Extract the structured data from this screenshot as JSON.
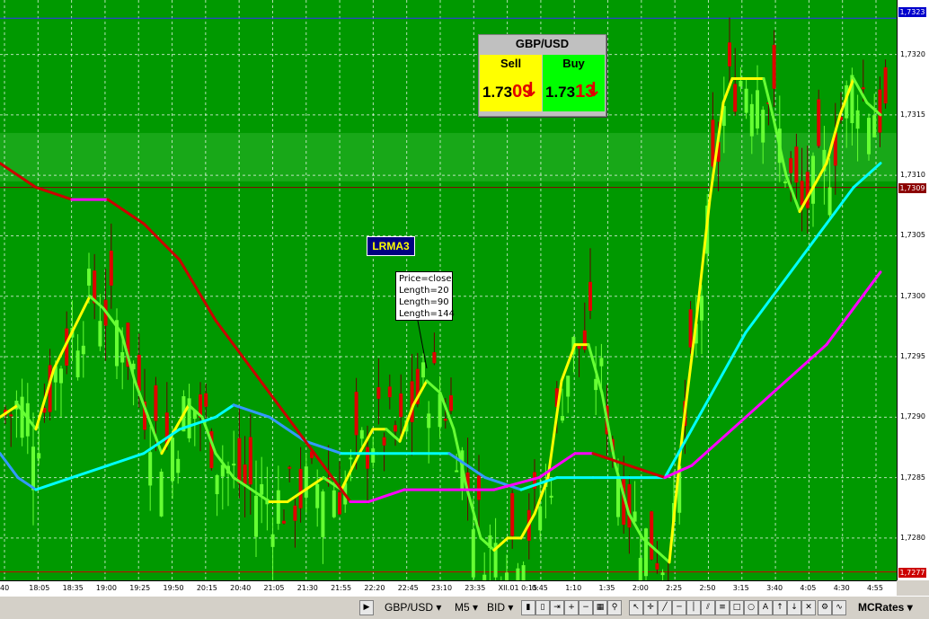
{
  "chart_data": {
    "type": "line",
    "symbol": "GBP/USD",
    "timeframe": "M5",
    "y_ticks": [
      1.728,
      1.7285,
      1.729,
      1.7295,
      1.73,
      1.7305,
      1.731,
      1.7315,
      1.732
    ],
    "y_tick_labels": [
      "1,7280",
      "1,7285",
      "1,7290",
      "1,7295",
      "1,7300",
      "1,7305",
      "1,7310",
      "1,7315",
      "1,7320"
    ],
    "ylim": [
      1.72765,
      1.73245
    ],
    "x_tick_labels": [
      "40",
      "18:05",
      "18:35",
      "19:00",
      "19:25",
      "19:50",
      "20:15",
      "20:40",
      "21:05",
      "21:30",
      "21:55",
      "22:20",
      "22:45",
      "23:10",
      "23:35",
      "XII.01 0:15",
      "0:45",
      "1:10",
      "1:35",
      "2:00",
      "2:25",
      "2:50",
      "3:15",
      "3:40",
      "4:05",
      "4:30",
      "4:55"
    ],
    "current_price_label": "1,7309",
    "high_label": "1,7323",
    "low_label": "1,7277",
    "series": [
      {
        "name": "Length=20",
        "color": "#ffff00",
        "alt_color": "#66ff33",
        "points": [
          [
            0,
            1.729
          ],
          [
            20,
            1.7291
          ],
          [
            40,
            1.7289
          ],
          [
            60,
            1.7294
          ],
          [
            80,
            1.7297
          ],
          [
            100,
            1.73
          ],
          [
            115,
            1.7299
          ],
          [
            135,
            1.7297
          ],
          [
            150,
            1.7293
          ],
          [
            170,
            1.7289
          ],
          [
            180,
            1.7287
          ],
          [
            195,
            1.7289
          ],
          [
            210,
            1.7291
          ],
          [
            225,
            1.729
          ],
          [
            240,
            1.7287
          ],
          [
            260,
            1.7285
          ],
          [
            280,
            1.7284
          ],
          [
            300,
            1.7283
          ],
          [
            320,
            1.7283
          ],
          [
            340,
            1.7284
          ],
          [
            360,
            1.7285
          ],
          [
            380,
            1.7284
          ],
          [
            400,
            1.7287
          ],
          [
            415,
            1.7289
          ],
          [
            430,
            1.7289
          ],
          [
            445,
            1.7288
          ],
          [
            460,
            1.7291
          ],
          [
            475,
            1.7293
          ],
          [
            490,
            1.7292
          ],
          [
            505,
            1.7289
          ],
          [
            520,
            1.7284
          ],
          [
            535,
            1.728
          ],
          [
            550,
            1.7279
          ],
          [
            565,
            1.728
          ],
          [
            580,
            1.728
          ],
          [
            595,
            1.7282
          ],
          [
            610,
            1.7285
          ],
          [
            625,
            1.7293
          ],
          [
            640,
            1.7296
          ],
          [
            655,
            1.7296
          ],
          [
            670,
            1.7292
          ],
          [
            685,
            1.7286
          ],
          [
            700,
            1.7282
          ],
          [
            715,
            1.728
          ],
          [
            730,
            1.7279
          ],
          [
            745,
            1.7278
          ],
          [
            760,
            1.7289
          ],
          [
            775,
            1.7298
          ],
          [
            790,
            1.7308
          ],
          [
            805,
            1.7316
          ],
          [
            815,
            1.7318
          ],
          [
            830,
            1.7318
          ],
          [
            850,
            1.7318
          ],
          [
            860,
            1.7315
          ],
          [
            875,
            1.731
          ],
          [
            890,
            1.7307
          ],
          [
            905,
            1.7309
          ],
          [
            920,
            1.7311
          ],
          [
            935,
            1.7315
          ],
          [
            950,
            1.7318
          ],
          [
            965,
            1.7316
          ],
          [
            980,
            1.7315
          ]
        ]
      },
      {
        "name": "Length=90",
        "color": "#00ffff",
        "alt_color": "#3399ff",
        "points": [
          [
            0,
            1.7287
          ],
          [
            20,
            1.7285
          ],
          [
            40,
            1.7284
          ],
          [
            80,
            1.7285
          ],
          [
            120,
            1.7286
          ],
          [
            160,
            1.7287
          ],
          [
            200,
            1.7289
          ],
          [
            240,
            1.729
          ],
          [
            260,
            1.7291
          ],
          [
            300,
            1.729
          ],
          [
            340,
            1.7288
          ],
          [
            380,
            1.7287
          ],
          [
            420,
            1.7287
          ],
          [
            460,
            1.7287
          ],
          [
            500,
            1.7287
          ],
          [
            540,
            1.7285
          ],
          [
            580,
            1.7284
          ],
          [
            620,
            1.7285
          ],
          [
            660,
            1.7285
          ],
          [
            700,
            1.7285
          ],
          [
            740,
            1.7285
          ],
          [
            770,
            1.7289
          ],
          [
            800,
            1.7293
          ],
          [
            830,
            1.7297
          ],
          [
            860,
            1.73
          ],
          [
            890,
            1.7303
          ],
          [
            920,
            1.7306
          ],
          [
            950,
            1.7309
          ],
          [
            980,
            1.7311
          ]
        ]
      },
      {
        "name": "Length=144",
        "color": "#ff00ff",
        "alt_color": "#cc0000",
        "points": [
          [
            0,
            1.7311
          ],
          [
            40,
            1.7309
          ],
          [
            80,
            1.7308
          ],
          [
            120,
            1.7308
          ],
          [
            160,
            1.7306
          ],
          [
            200,
            1.7303
          ],
          [
            240,
            1.7298
          ],
          [
            270,
            1.7295
          ],
          [
            300,
            1.7292
          ],
          [
            330,
            1.7289
          ],
          [
            360,
            1.7286
          ],
          [
            390,
            1.7283
          ],
          [
            410,
            1.7283
          ],
          [
            450,
            1.7284
          ],
          [
            500,
            1.7284
          ],
          [
            550,
            1.7284
          ],
          [
            600,
            1.7285
          ],
          [
            640,
            1.7287
          ],
          [
            660,
            1.7287
          ],
          [
            700,
            1.7286
          ],
          [
            740,
            1.7285
          ],
          [
            770,
            1.7286
          ],
          [
            800,
            1.7288
          ],
          [
            830,
            1.729
          ],
          [
            860,
            1.7292
          ],
          [
            890,
            1.7294
          ],
          [
            920,
            1.7296
          ],
          [
            950,
            1.7299
          ],
          [
            980,
            1.7302
          ]
        ]
      }
    ]
  },
  "quote_panel": {
    "title": "GBP/USD",
    "sell_label": "Sell",
    "sell_prefix": "1.73",
    "sell_pips": "09",
    "buy_label": "Buy",
    "buy_prefix": "1.73",
    "buy_pips": "13",
    "arrow": "↓",
    "sell_color": "#ffff00",
    "buy_color": "#00ff00"
  },
  "indicator": {
    "name": "LRMA3",
    "params": [
      "Price=close",
      "Length=20",
      "Length=90",
      "Length=144"
    ]
  },
  "toolbar": {
    "symbol": "GBP/USD",
    "timeframe": "M5",
    "price_type": "BID",
    "brand": "MCRates",
    "dropdown_glyph": "▾"
  }
}
